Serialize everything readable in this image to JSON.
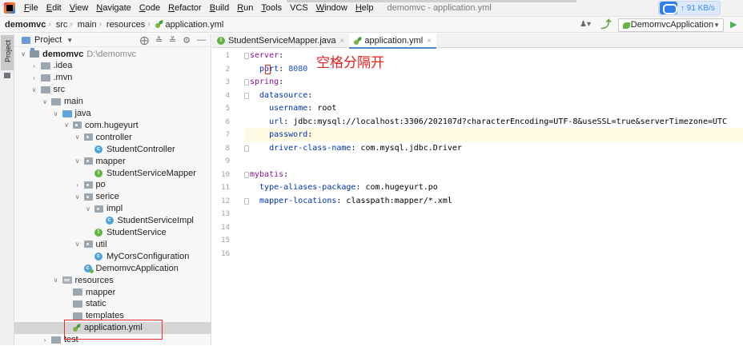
{
  "menubar": {
    "items": [
      {
        "label": "File",
        "mnemonic": "F",
        "rest": "ile"
      },
      {
        "label": "Edit",
        "mnemonic": "E",
        "rest": "dit"
      },
      {
        "label": "View",
        "mnemonic": "V",
        "rest": "iew"
      },
      {
        "label": "Navigate",
        "mnemonic": "N",
        "rest": "avigate"
      },
      {
        "label": "Code",
        "mnemonic": "C",
        "rest": "ode"
      },
      {
        "label": "Refactor",
        "mnemonic": "R",
        "rest": "efactor"
      },
      {
        "label": "Build",
        "mnemonic": "B",
        "rest": "uild"
      },
      {
        "label": "Run",
        "mnemonic": "R",
        "rest": "un"
      },
      {
        "label": "Tools",
        "mnemonic": "T",
        "rest": "ools"
      },
      {
        "label": "VCS",
        "mnemonic": "",
        "rest": "VCS"
      },
      {
        "label": "Window",
        "mnemonic": "W",
        "rest": "indow"
      },
      {
        "label": "Help",
        "mnemonic": "H",
        "rest": "elp"
      }
    ],
    "window_title": "demomvc - application.yml",
    "net_speed": "↑ 91 KB/s"
  },
  "navbar": {
    "crumbs": [
      "demomvc",
      "src",
      "main",
      "resources",
      "application.yml"
    ],
    "run_config": "DemomvcApplication"
  },
  "stripe": {
    "project_label": "Project"
  },
  "project_panel": {
    "title": "Project",
    "tree": [
      {
        "label": "demomvc",
        "path": "D:\\demomvc",
        "indent": 0,
        "toggle": "open",
        "icon": "module",
        "bold": true
      },
      {
        "label": ".idea",
        "indent": 1,
        "toggle": "closed",
        "icon": "folder"
      },
      {
        "label": ".mvn",
        "indent": 1,
        "toggle": "closed",
        "icon": "folder"
      },
      {
        "label": "src",
        "indent": 1,
        "toggle": "open",
        "icon": "folder"
      },
      {
        "label": "main",
        "indent": 2,
        "toggle": "open",
        "icon": "folder"
      },
      {
        "label": "java",
        "indent": 3,
        "toggle": "open",
        "icon": "folder-blue"
      },
      {
        "label": "com.hugeyurt",
        "indent": 4,
        "toggle": "open",
        "icon": "package"
      },
      {
        "label": "controller",
        "indent": 5,
        "toggle": "open",
        "icon": "package"
      },
      {
        "label": "StudentController",
        "indent": 6,
        "toggle": "none",
        "icon": "class"
      },
      {
        "label": "mapper",
        "indent": 5,
        "toggle": "open",
        "icon": "package"
      },
      {
        "label": "StudentServiceMapper",
        "indent": 6,
        "toggle": "none",
        "icon": "interface"
      },
      {
        "label": "po",
        "indent": 5,
        "toggle": "closed",
        "icon": "package"
      },
      {
        "label": "serice",
        "indent": 5,
        "toggle": "open",
        "icon": "package"
      },
      {
        "label": "impl",
        "indent": 6,
        "toggle": "open",
        "icon": "package"
      },
      {
        "label": "StudentServiceImpl",
        "indent": 7,
        "toggle": "none",
        "icon": "class"
      },
      {
        "label": "StudentService",
        "indent": 6,
        "toggle": "none",
        "icon": "interface"
      },
      {
        "label": "util",
        "indent": 5,
        "toggle": "open",
        "icon": "package"
      },
      {
        "label": "MyCorsConfiguration",
        "indent": 6,
        "toggle": "none",
        "icon": "class"
      },
      {
        "label": "DemomvcApplication",
        "indent": 5,
        "toggle": "none",
        "icon": "spring"
      },
      {
        "label": "resources",
        "indent": 3,
        "toggle": "open",
        "icon": "resources"
      },
      {
        "label": "mapper",
        "indent": 4,
        "toggle": "none",
        "icon": "folder"
      },
      {
        "label": "static",
        "indent": 4,
        "toggle": "none",
        "icon": "folder"
      },
      {
        "label": "templates",
        "indent": 4,
        "toggle": "none",
        "icon": "folder"
      },
      {
        "label": "application.yml",
        "indent": 4,
        "toggle": "none",
        "icon": "yml",
        "selected": true
      },
      {
        "label": "test",
        "indent": 2,
        "toggle": "closed",
        "icon": "folder"
      }
    ]
  },
  "editor": {
    "tabs": [
      {
        "label": "StudentServiceMapper.java",
        "icon": "interface",
        "active": false
      },
      {
        "label": "application.yml",
        "icon": "yml",
        "active": true
      }
    ],
    "lines": [
      {
        "no": "1",
        "indent": 0,
        "key": "server",
        "value": "",
        "vtype": ""
      },
      {
        "no": "2",
        "indent": 2,
        "key": "port",
        "value": "8080",
        "vtype": "num"
      },
      {
        "no": "3",
        "indent": 0,
        "key": "spring",
        "value": "",
        "vtype": ""
      },
      {
        "no": "4",
        "indent": 2,
        "key": "datasource",
        "value": "",
        "vtype": ""
      },
      {
        "no": "5",
        "indent": 4,
        "key": "username",
        "value": "root",
        "vtype": "str"
      },
      {
        "no": "6",
        "indent": 4,
        "key": "url",
        "value": "jdbc:mysql://localhost:3306/202107d?characterEncoding=UTF-8&useSSL=true&serverTimezone=UTC",
        "vtype": "str"
      },
      {
        "no": "7",
        "indent": 4,
        "key": "password",
        "value": "",
        "vtype": "str"
      },
      {
        "no": "8",
        "indent": 4,
        "key": "driver-class-name",
        "value": "com.mysql.jdbc.Driver",
        "vtype": "str"
      },
      {
        "no": "9",
        "indent": 0,
        "key": "",
        "value": "",
        "vtype": ""
      },
      {
        "no": "10",
        "indent": 0,
        "key": "mybatis",
        "value": "",
        "vtype": ""
      },
      {
        "no": "11",
        "indent": 2,
        "key": "type-aliases-package",
        "value": "com.hugeyurt.po",
        "vtype": "str"
      },
      {
        "no": "12",
        "indent": 2,
        "key": "mapper-locations",
        "value": "classpath:mapper/*.xml",
        "vtype": "str"
      },
      {
        "no": "13",
        "indent": 0,
        "key": "",
        "value": "",
        "vtype": ""
      },
      {
        "no": "14",
        "indent": 0,
        "key": "",
        "value": "",
        "vtype": ""
      },
      {
        "no": "15",
        "indent": 0,
        "key": "",
        "value": "",
        "vtype": ""
      },
      {
        "no": "16",
        "indent": 0,
        "key": "",
        "value": "",
        "vtype": ""
      }
    ],
    "annotation": "空格分隔开"
  },
  "colors": {
    "accent": "#4a88c7",
    "annotation_red": "#e02020",
    "yaml_key": "#0033b3",
    "yaml_value": "#067d17"
  }
}
